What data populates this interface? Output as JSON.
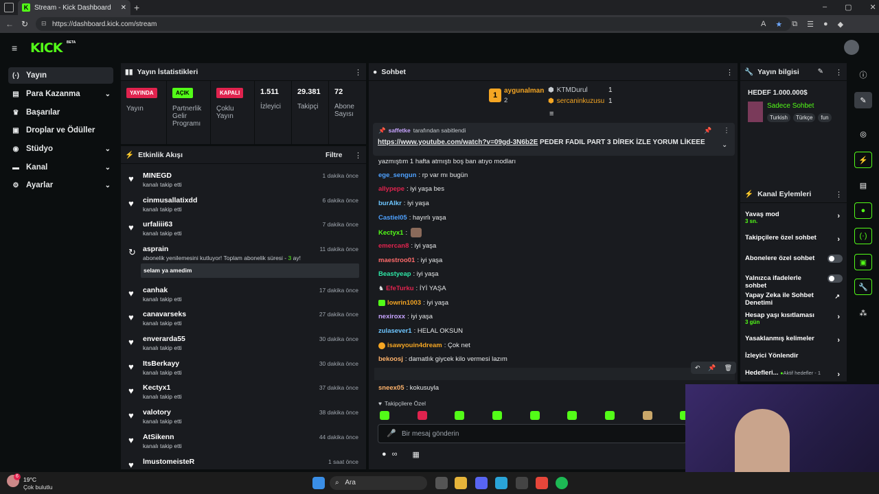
{
  "browser": {
    "tab_title": "Stream - Kick Dashboard",
    "tab_favicon": "K",
    "url": "https://dashboard.kick.com/stream"
  },
  "header": {
    "logo": "KICK",
    "beta": "BETA"
  },
  "sidebar": {
    "items": [
      {
        "label": "Yayın",
        "icon": "broadcast-icon"
      },
      {
        "label": "Para Kazanma",
        "icon": "money-icon"
      },
      {
        "label": "Başarılar",
        "icon": "trophy-icon"
      },
      {
        "label": "Droplar ve Ödüller",
        "icon": "gift-icon"
      },
      {
        "label": "Stüdyo",
        "icon": "studio-icon"
      },
      {
        "label": "Kanal",
        "icon": "user-icon"
      },
      {
        "label": "Ayarlar",
        "icon": "gear-icon"
      }
    ]
  },
  "stats": {
    "title": "Yayın İstatistikleri",
    "cells": [
      {
        "badge": "YAYINDA",
        "label": "Yayın"
      },
      {
        "badge": "AÇIK",
        "label": "Partnerlik Gelir Programı"
      },
      {
        "badge": "KAPALI",
        "label": "Çoklu Yayın"
      },
      {
        "value": "1.511",
        "label": "İzleyici"
      },
      {
        "value": "29.381",
        "label": "Takipçi"
      },
      {
        "value": "72",
        "label": "Abone Sayısı"
      }
    ]
  },
  "activity": {
    "title": "Etkinlik Akışı",
    "filter": "Filtre",
    "rows": [
      {
        "name": "MINEGD",
        "desc": "kanalı takip etti",
        "time": "1 dakika önce"
      },
      {
        "name": "cinmusallatixdd",
        "desc": "kanalı takip etti",
        "time": "6 dakika önce"
      },
      {
        "name": "urfaliii63",
        "desc": "kanalı takip etti",
        "time": "7 dakika önce"
      },
      {
        "name": "asprain",
        "desc_prefix": "abonelik yenilemesini kutluyor! Toplam abonelik süresi - ",
        "desc_num": "3",
        "desc_suffix": " ay!",
        "message": "selam ya amedim",
        "time": "11 dakika önce"
      },
      {
        "name": "canhak",
        "desc": "kanalı takip etti",
        "time": "17 dakika önce"
      },
      {
        "name": "canavarseks",
        "desc": "kanalı takip etti",
        "time": "27 dakika önce"
      },
      {
        "name": "enverarda55",
        "desc": "kanalı takip etti",
        "time": "30 dakika önce"
      },
      {
        "name": "ItsBerkayy",
        "desc": "kanalı takip etti",
        "time": "30 dakika önce"
      },
      {
        "name": "Kectyx1",
        "desc": "kanalı takip etti",
        "time": "37 dakika önce"
      },
      {
        "name": "valotory",
        "desc": "kanalı takip etti",
        "time": "38 dakika önce"
      },
      {
        "name": "AtSikenn",
        "desc": "kanalı takip etti",
        "time": "44 dakika önce"
      },
      {
        "name": "lmustomeisteR",
        "desc": "",
        "time": "1 saat önce"
      }
    ]
  },
  "chat": {
    "title": "Sohbet",
    "leaderboard": [
      {
        "name": "aygunalman",
        "count": "2",
        "color": "#f5a623"
      },
      {
        "name": "KTMDurul",
        "count": "1",
        "color": "#c7ccd1"
      },
      {
        "name": "sercaninkuzusu",
        "count": "1",
        "color": "#f5a623"
      }
    ],
    "pinned": {
      "by_user": "saffetke",
      "by_suffix": "tarafından sabitlendi",
      "link": "https://www.youtube.com/watch?v=09gd-3N6b2E",
      "text": " PEDER FADIL PART 3 DİREK İZLE YORUM LİKEEE"
    },
    "messages": [
      {
        "user": "",
        "text": "yazmıştım 1 hafta atmıştı boş ban atıyo modları",
        "color": "#e7e9ea"
      },
      {
        "user": "ege_sengun",
        "text": ": rp var mı bugün",
        "color": "#4ea1ff"
      },
      {
        "user": "allypepe",
        "text": ": iyi yaşa bes",
        "color": "#e0234e"
      },
      {
        "user": "burAlkr",
        "text": ": iyi yaşa",
        "color": "#6ec6ff"
      },
      {
        "user": "Castiel05",
        "text": ": hayırlı yaşa",
        "color": "#4ea1ff"
      },
      {
        "user": "Kectyx1",
        "text": ":",
        "color": "#53fc18",
        "emote": true
      },
      {
        "user": "emercan8",
        "text": ": iyi yaşa",
        "color": "#e0234e"
      },
      {
        "user": "maestroo01",
        "text": ": iyi yaşa",
        "color": "#ff6b6b"
      },
      {
        "user": "Beastyeap",
        "text": ": iyi yaşa",
        "color": "#2ee6a6"
      },
      {
        "user": "EfeTurku",
        "text": ": İYİ YAŞA",
        "color": "#e0234e"
      },
      {
        "user": "lowrin1003",
        "text": ": iyi yaşa",
        "color": "#f5a623"
      },
      {
        "user": "nexiroxx",
        "text": ": iyi yaşa",
        "color": "#c7a4ff"
      },
      {
        "user": "zulasever1",
        "text": ": HELAL OKSUN",
        "color": "#6ec6ff"
      },
      {
        "user": "isawyouin4dream",
        "text": ": Çok net",
        "color": "#f5a623"
      },
      {
        "user": "bekoosj",
        "text": ": damatlık giycek kilo vermesi lazım",
        "color": "#ffb36b"
      },
      {
        "user": "Kectyx1",
        "text": ":",
        "color": "#53fc18",
        "emote": true
      },
      {
        "user": "sneex05",
        "text": ": kokusuyla",
        "color": "#ffb36b"
      }
    ],
    "followers_only": "Takipçilere Özel",
    "input_placeholder": "Bir mesaj gönderin",
    "infinity": "∞"
  },
  "stream_info": {
    "title": "Yayın bilgisi",
    "stream_title": "HEDEF 1.000.000$",
    "category": "Sadece Sohbet",
    "tags": [
      "Turkish",
      "Türkçe",
      "fun"
    ]
  },
  "channel_actions": {
    "title": "Kanal Eylemleri",
    "items": [
      {
        "label": "Yavaş mod",
        "sub": "3 sn.",
        "control": "chevron"
      },
      {
        "label": "Takipçilere özel sohbet",
        "control": "chevron"
      },
      {
        "label": "Abonelere özel sohbet",
        "control": "toggle"
      },
      {
        "label": "Yalnızca ifadelerle sohbet",
        "control": "toggle"
      },
      {
        "label": "Yapay Zeka ile Sohbet Denetimi",
        "control": "external"
      },
      {
        "label": "Hesap yaşı kısıtlaması",
        "sub": "3 gün",
        "control": "chevron"
      },
      {
        "label": "Yasaklanmış kelimeler",
        "control": "chevron"
      },
      {
        "label": "İzleyici Yönlendir",
        "control": "none"
      },
      {
        "label": "Hedefleri...",
        "sub_inline": "Aktif hedefler - 1",
        "control": "chevron"
      }
    ]
  },
  "taskbar": {
    "weather_temp": "19°C",
    "weather_desc": "Çok bulutlu",
    "search": "Ara",
    "notif": "6"
  },
  "colors": {
    "brand": "#53fc18",
    "live": "#e0234e",
    "panel": "#191b1f"
  }
}
